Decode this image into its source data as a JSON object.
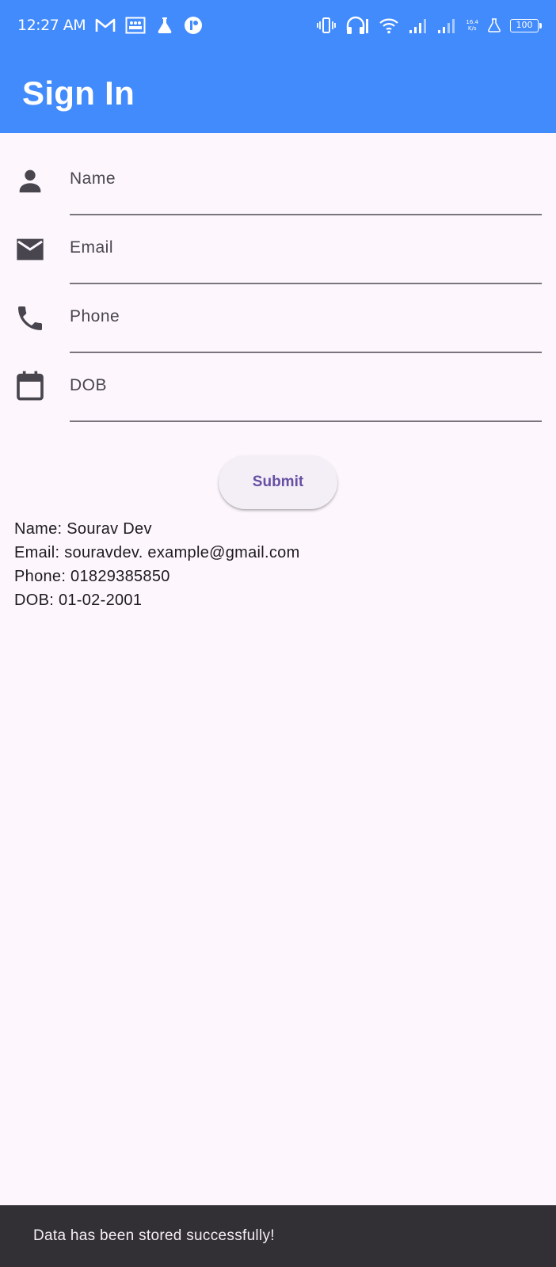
{
  "status_bar": {
    "time": "12:27 AM",
    "net_speed": "16.4",
    "net_unit": "K/s",
    "battery": "100",
    "icons": [
      "gmail-icon",
      "gallery-icon",
      "flask-icon",
      "app-icon",
      "vibrate-icon",
      "headphones-icon",
      "wifi-icon",
      "signal-icon",
      "signal-icon",
      "flask-icon",
      "battery-icon"
    ]
  },
  "header": {
    "title": "Sign In",
    "background": "#428bfd"
  },
  "form": {
    "name_label": "Name",
    "email_label": "Email",
    "phone_label": "Phone",
    "dob_label": "DOB",
    "submit_label": "Submit"
  },
  "output": {
    "name": "Name: Sourav Dev",
    "email": "Email: souravdev. example@gmail.com",
    "phone": "Phone: 01829385850",
    "dob": "DOB: 01-02-2001"
  },
  "snackbar": {
    "message": "Data has been stored successfully!"
  },
  "colors": {
    "accent": "#6750a4",
    "background": "#fdf7fd",
    "snackbar": "#322f35"
  }
}
